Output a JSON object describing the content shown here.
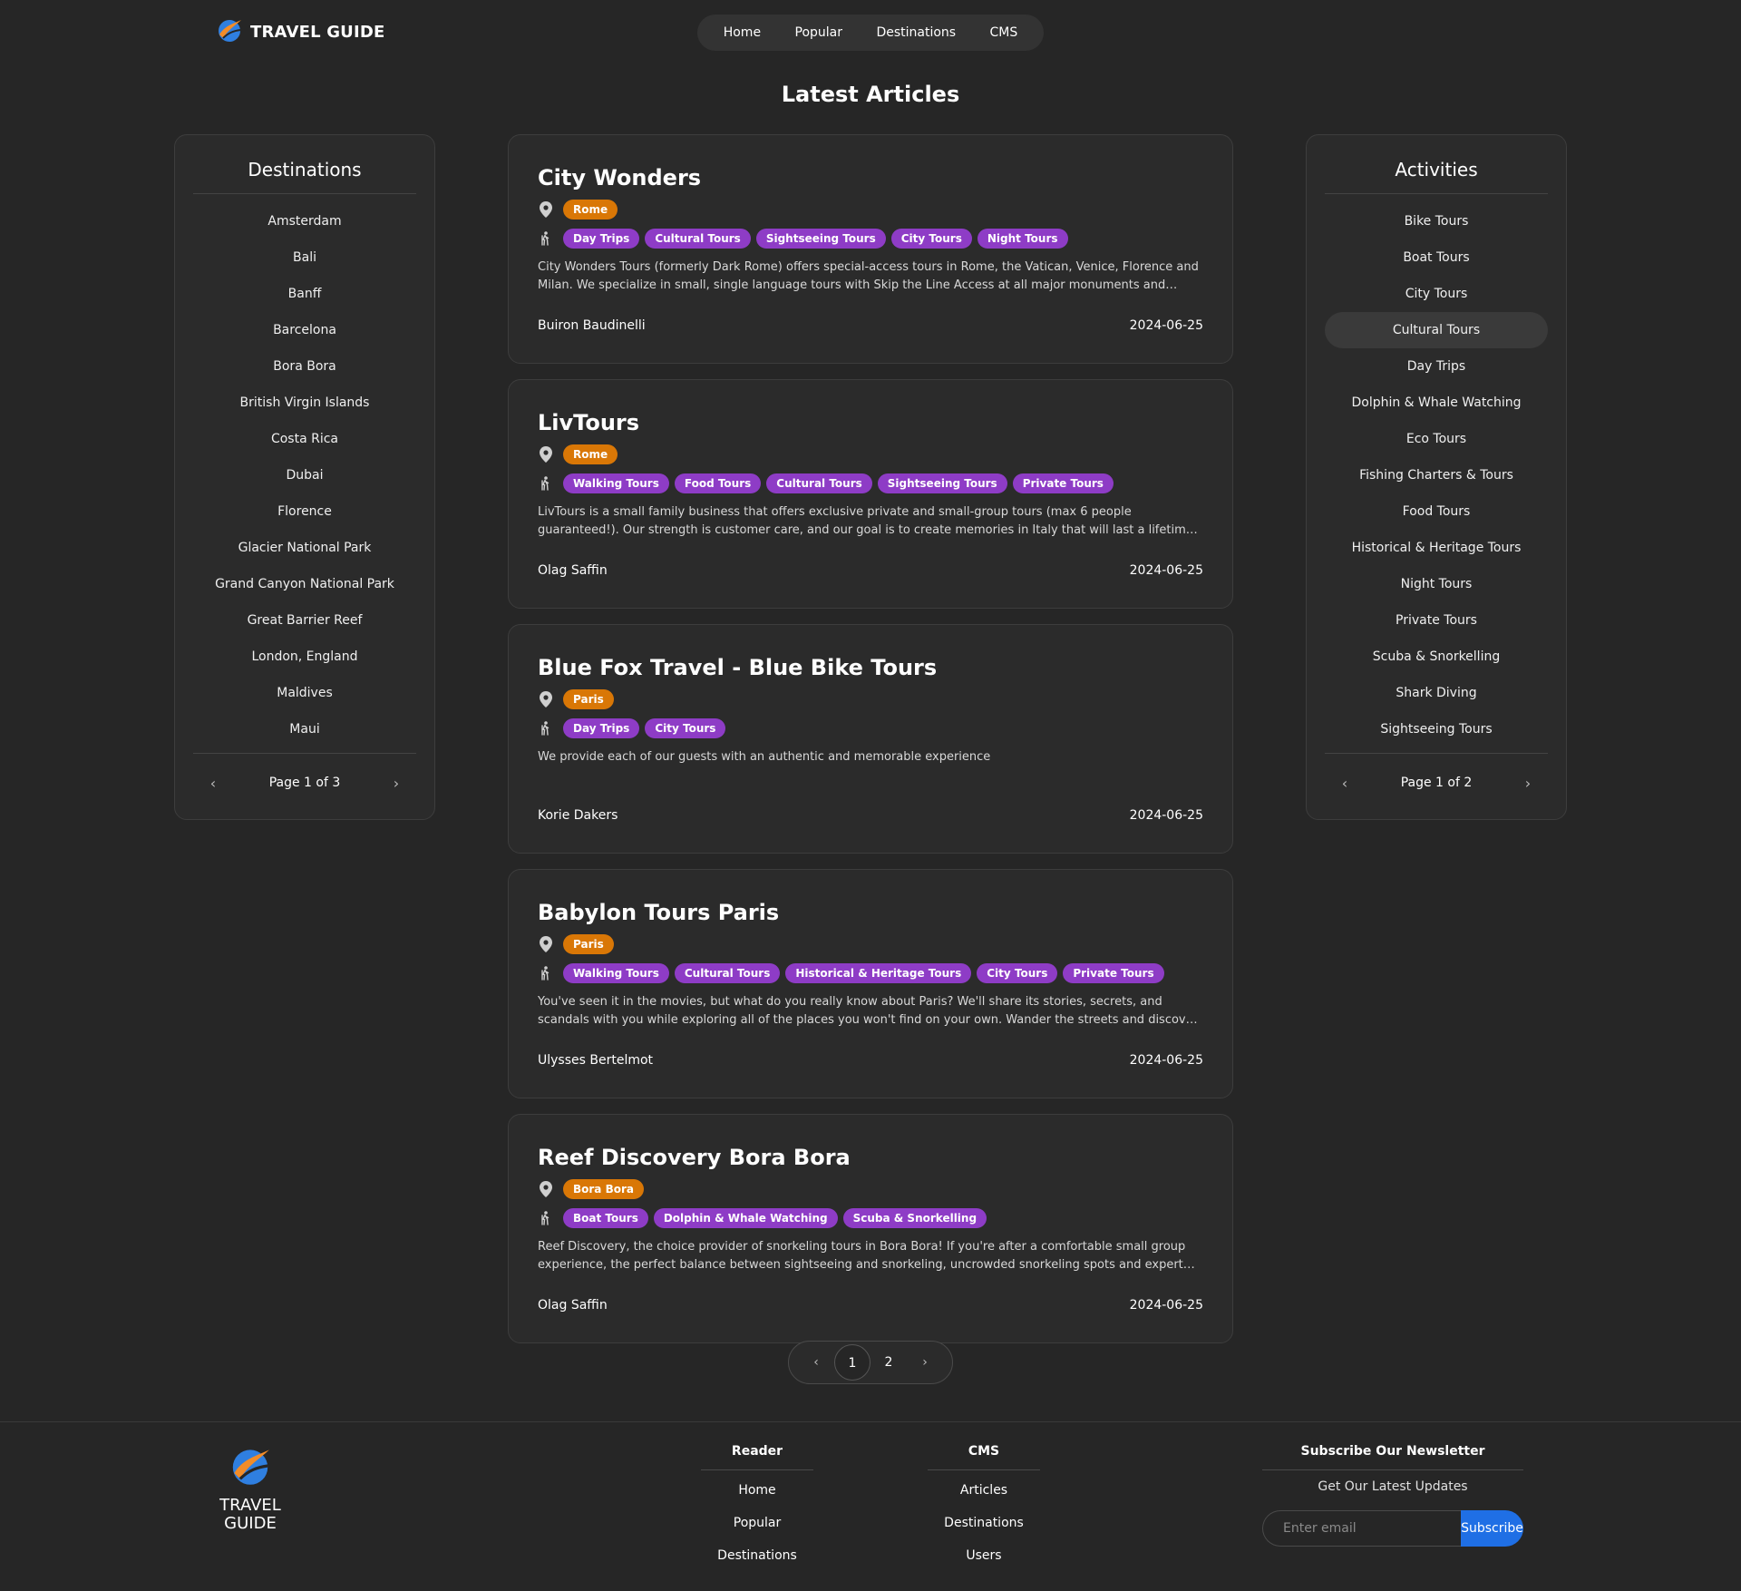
{
  "header": {
    "brand": "TRAVEL GUIDE",
    "nav": [
      "Home",
      "Popular",
      "Destinations",
      "CMS"
    ]
  },
  "page_title": "Latest Articles",
  "destinations": {
    "title": "Destinations",
    "items": [
      "Amsterdam",
      "Bali",
      "Banff",
      "Barcelona",
      "Bora Bora",
      "British Virgin Islands",
      "Costa Rica",
      "Dubai",
      "Florence",
      "Glacier National Park",
      "Grand Canyon National Park",
      "Great Barrier Reef",
      "London, England",
      "Maldives",
      "Maui"
    ],
    "page_label": "Page 1 of 3",
    "prev": "‹",
    "next": "›"
  },
  "activities": {
    "title": "Activities",
    "items": [
      "Bike Tours",
      "Boat Tours",
      "City Tours",
      "Cultural Tours",
      "Day Trips",
      "Dolphin & Whale Watching",
      "Eco Tours",
      "Fishing Charters & Tours",
      "Food Tours",
      "Historical & Heritage Tours",
      "Night Tours",
      "Private Tours",
      "Scuba & Snorkelling",
      "Shark Diving",
      "Sightseeing Tours"
    ],
    "active": "Cultural Tours",
    "page_label": "Page 1 of 2",
    "prev": "‹",
    "next": "›"
  },
  "articles": [
    {
      "title": "City Wonders",
      "location": "Rome",
      "tags": [
        "Day Trips",
        "Cultural Tours",
        "Sightseeing Tours",
        "City Tours",
        "Night Tours"
      ],
      "description": "City Wonders Tours (formerly Dark Rome) offers special-access tours in Rome, the Vatican, Venice, Florence and Milan. We specialize in small, single language tours with Skip the Line Access at all major monuments and attractions.",
      "author": "Buiron Baudinelli",
      "date": "2024-06-25"
    },
    {
      "title": "LivTours",
      "location": "Rome",
      "tags": [
        "Walking Tours",
        "Food Tours",
        "Cultural Tours",
        "Sightseeing Tours",
        "Private Tours"
      ],
      "description": "LivTours is a small family business that offers exclusive private and small-group tours (max 6 people guaranteed!). Our strength is customer care, and our goal is to create memories in Italy that will last a lifetime. Join us.",
      "author": "Olag Saffin",
      "date": "2024-06-25"
    },
    {
      "title": "Blue Fox Travel - Blue Bike Tours",
      "location": "Paris",
      "tags": [
        "Day Trips",
        "City Tours"
      ],
      "description": "We provide each of our guests with an authentic and memorable experience",
      "author": "Korie Dakers",
      "date": "2024-06-25"
    },
    {
      "title": "Babylon Tours Paris",
      "location": "Paris",
      "tags": [
        "Walking Tours",
        "Cultural Tours",
        "Historical & Heritage Tours",
        "City Tours",
        "Private Tours"
      ],
      "description": "You've seen it in the movies, but what do you really know about Paris? We'll share its stories, secrets, and scandals with you while exploring all of the places you won't find on your own. Wander the streets and discover the real Paris.",
      "author": "Ulysses Bertelmot",
      "date": "2024-06-25"
    },
    {
      "title": "Reef Discovery Bora Bora",
      "location": "Bora Bora",
      "tags": [
        "Boat Tours",
        "Dolphin & Whale Watching",
        "Scuba & Snorkelling"
      ],
      "description": "Reef Discovery, the choice provider of snorkeling tours in Bora Bora! If you're after a comfortable small group experience, the perfect balance between sightseeing and snorkeling, uncrowded snorkeling spots and expert guides.",
      "author": "Olag Saffin",
      "date": "2024-06-25"
    }
  ],
  "pagination": {
    "prev": "‹",
    "pages": [
      "1",
      "2"
    ],
    "current": "1",
    "next": "›"
  },
  "footer": {
    "brand_line1": "TRAVEL",
    "brand_line2": "GUIDE",
    "reader": {
      "title": "Reader",
      "links": [
        "Home",
        "Popular",
        "Destinations"
      ]
    },
    "cms": {
      "title": "CMS",
      "links": [
        "Articles",
        "Destinations",
        "Users"
      ]
    },
    "newsletter": {
      "title": "Subscribe Our Newsletter",
      "subtitle": "Get Our Latest Updates",
      "placeholder": "Enter email",
      "button": "Subscribe"
    }
  },
  "colors": {
    "location_pill": "#d97706",
    "activity_pill": "#8e3cc6",
    "subscribe_button": "#1f6fe5",
    "background": "#262626"
  },
  "icons": {
    "logo": "travel-globe-logo",
    "location": "map-pin-icon",
    "activity": "hiker-icon"
  }
}
